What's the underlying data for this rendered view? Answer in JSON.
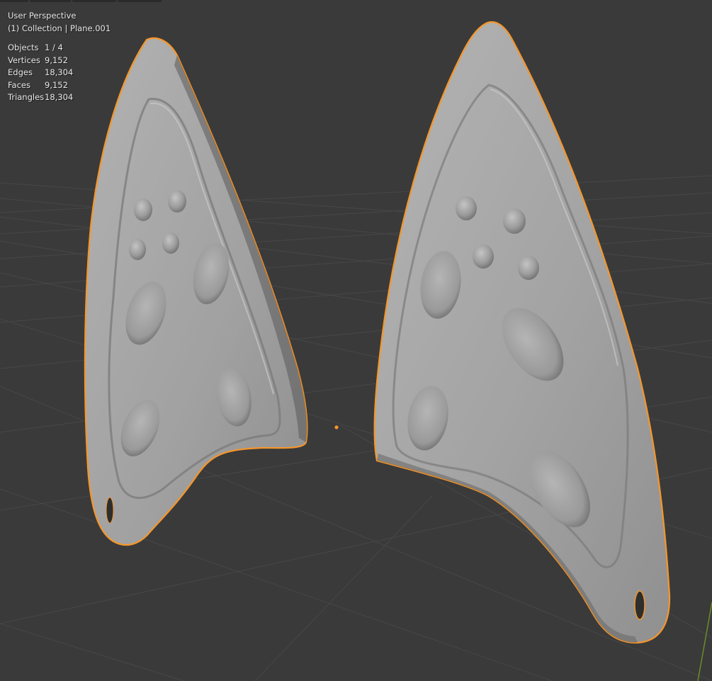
{
  "viewport": {
    "perspective_label": "User Perspective",
    "collection_label": "(1) Collection | Plane.001"
  },
  "stats": [
    {
      "label": "Objects",
      "value": "1 / 4"
    },
    {
      "label": "Vertices",
      "value": "9,152"
    },
    {
      "label": "Edges",
      "value": "18,304"
    },
    {
      "label": "Faces",
      "value": "9,152"
    },
    {
      "label": "Triangles",
      "value": "18,304"
    }
  ],
  "colors": {
    "background": "#3a3a3a",
    "grid_line": "#474747",
    "mesh": "#a3a3a3",
    "selection_outline": "#f5962a",
    "origin_point": "#f5962a",
    "axis_y_green": "#6a8c2a"
  },
  "icons": {
    "origin": "object-origin-icon",
    "axis": "y-axis-line"
  }
}
